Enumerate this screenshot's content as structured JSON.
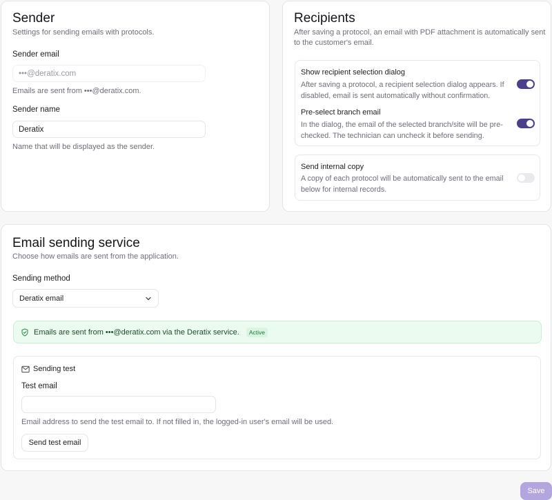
{
  "sender": {
    "title": "Sender",
    "subtitle": "Settings for sending emails with protocols.",
    "email_label": "Sender email",
    "email_value": "•••@deratix.com",
    "email_help": "Emails are sent from •••@deratix.com.",
    "name_label": "Sender name",
    "name_value": "Deratix",
    "name_help": "Name that will be displayed as the sender."
  },
  "recipients": {
    "title": "Recipients",
    "subtitle_line1": "After saving a protocol, an email with PDF attachment is automatically sent",
    "subtitle_line2": "to the customer's email.",
    "show_dialog": {
      "title": "Show recipient selection dialog",
      "desc_line1": "After saving a protocol, a recipient selection dialog appears. If",
      "desc_line2": "disabled, email is sent automatically without confirmation.",
      "enabled": true
    },
    "preselect": {
      "title": "Pre-select branch email",
      "desc_line1": "In the dialog, the email of the selected branch/site will be pre-",
      "desc_line2": "checked. The technician can uncheck it before sending.",
      "enabled": true
    },
    "internal_copy": {
      "title": "Send internal copy",
      "desc_line1": "A copy of each protocol will be automatically sent to the email",
      "desc_line2": "below for internal records.",
      "enabled": false
    }
  },
  "service": {
    "title": "Email sending service",
    "subtitle": "Choose how emails are sent from the application.",
    "method_label": "Sending method",
    "method_value": "Deratix email",
    "banner_text": "Emails are sent from •••@deratix.com via the Deratix service.",
    "banner_badge": "Active",
    "test": {
      "title": "Sending test",
      "email_label": "Test email",
      "email_value": "",
      "help": "Email address to send the test email to. If not filled in, the logged-in user's email will be used.",
      "button": "Send test email"
    }
  },
  "save_label": "Save",
  "colors": {
    "toggle_on": "#4b3f8c",
    "save_button": "#b3a6de",
    "banner_bg": "#ebfbef"
  }
}
